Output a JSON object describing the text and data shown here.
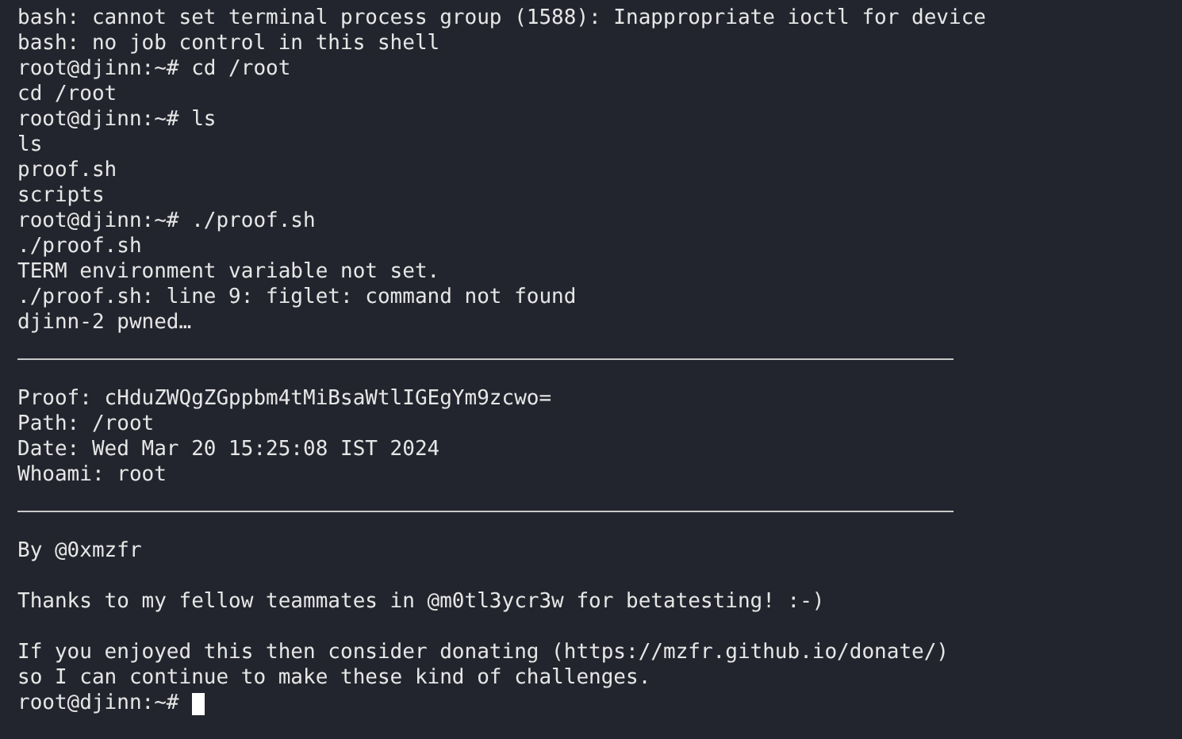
{
  "terminal": {
    "lines": [
      {
        "kind": "text",
        "text": "bash: cannot set terminal process group (1588): Inappropriate ioctl for device"
      },
      {
        "kind": "text",
        "text": "bash: no job control in this shell"
      },
      {
        "kind": "text",
        "text": "root@djinn:~# cd /root"
      },
      {
        "kind": "text",
        "text": "cd /root"
      },
      {
        "kind": "text",
        "text": "root@djinn:~# ls"
      },
      {
        "kind": "text",
        "text": "ls"
      },
      {
        "kind": "text",
        "text": "proof.sh"
      },
      {
        "kind": "text",
        "text": "scripts"
      },
      {
        "kind": "text",
        "text": "root@djinn:~# ./proof.sh"
      },
      {
        "kind": "text",
        "text": "./proof.sh"
      },
      {
        "kind": "text",
        "text": "TERM environment variable not set."
      },
      {
        "kind": "text",
        "text": "./proof.sh: line 9: figlet: command not found"
      },
      {
        "kind": "text",
        "text": "djinn-2 pwned…"
      },
      {
        "kind": "rule"
      },
      {
        "kind": "blank"
      },
      {
        "kind": "text",
        "text": "Proof: cHduZWQgZGppbm4tMiBsaWtlIGEgYm9zcwo="
      },
      {
        "kind": "text",
        "text": "Path: /root"
      },
      {
        "kind": "text",
        "text": "Date: Wed Mar 20 15:25:08 IST 2024"
      },
      {
        "kind": "text",
        "text": "Whoami: root"
      },
      {
        "kind": "rule"
      },
      {
        "kind": "blank"
      },
      {
        "kind": "text",
        "text": "By @0xmzfr"
      },
      {
        "kind": "blank"
      },
      {
        "kind": "text",
        "text": "Thanks to my fellow teammates in @m0tl3ycr3w for betatesting! :-)"
      },
      {
        "kind": "blank"
      },
      {
        "kind": "text",
        "text": "If you enjoyed this then consider donating (https://mzfr.github.io/donate/)"
      },
      {
        "kind": "text",
        "text": "so I can continue to make these kind of challenges."
      },
      {
        "kind": "prompt",
        "text": "root@djinn:~#",
        "cursor": true
      }
    ]
  }
}
